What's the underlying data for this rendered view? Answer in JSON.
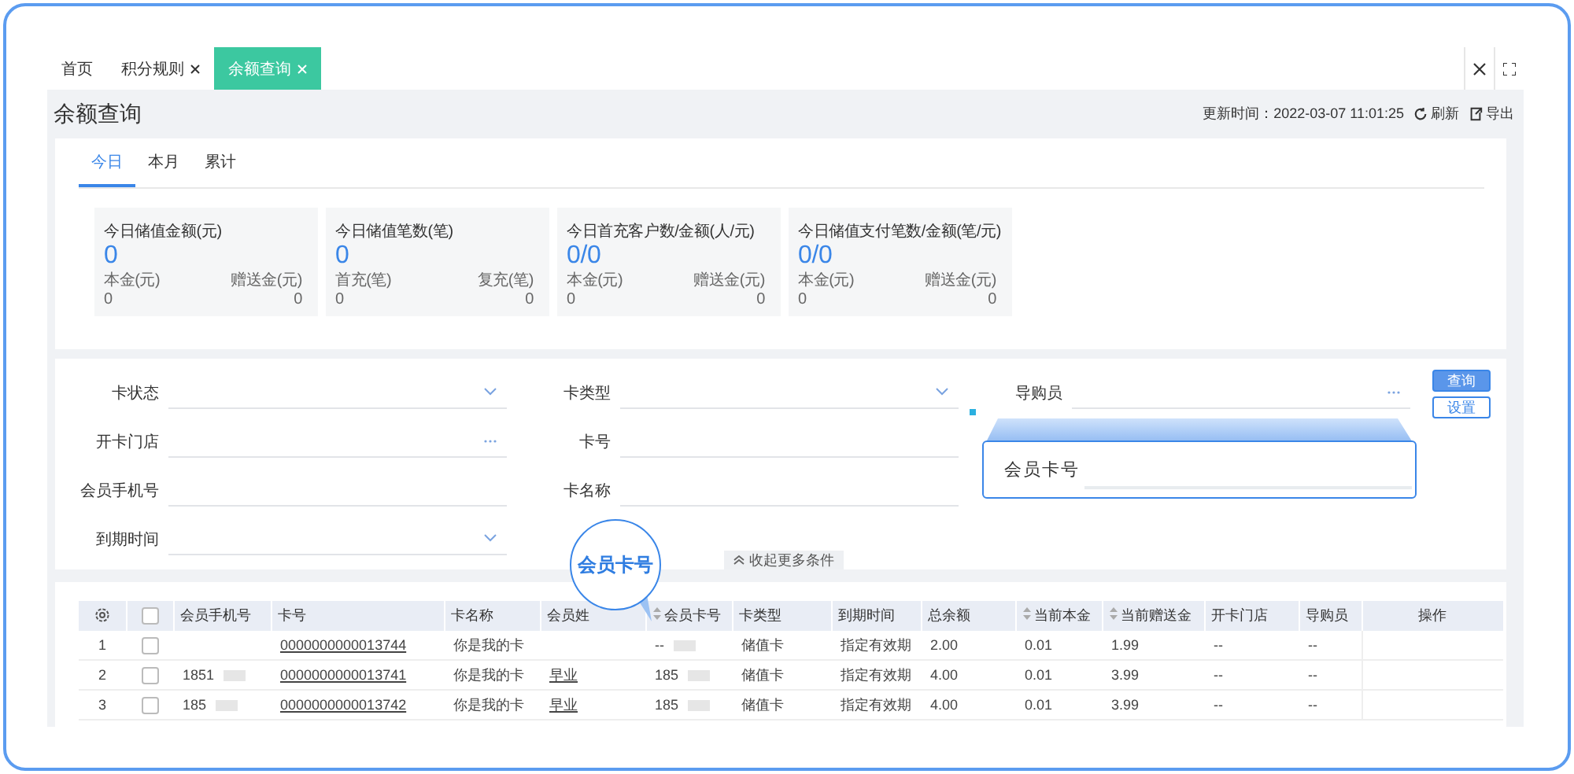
{
  "tabs": [
    {
      "label": "首页",
      "closable": false,
      "selected": false
    },
    {
      "label": "积分规则",
      "closable": true,
      "selected": false
    },
    {
      "label": "余额查询",
      "closable": true,
      "selected": true
    }
  ],
  "page_title": "余额查询",
  "update_time": "更新时间：2022-03-07 11:01:25",
  "actions": [
    "刷新",
    "导出"
  ],
  "period_tabs": [
    {
      "label": "今日",
      "selected": true
    },
    {
      "label": "本月",
      "selected": false
    },
    {
      "label": "累计",
      "selected": false
    }
  ],
  "stat_cards": [
    {
      "title": "今日储值金额(元)",
      "value": "0",
      "left_label": "本金(元)",
      "left_value": "0",
      "right_label": "赠送金(元)",
      "right_value": "0"
    },
    {
      "title": "今日储值笔数(笔)",
      "value": "0",
      "left_label": "首充(笔)",
      "left_value": "0",
      "right_label": "复充(笔)",
      "right_value": "0"
    },
    {
      "title": "今日首充客户数/金额(人/元)",
      "value": "0/0",
      "left_label": "本金(元)",
      "left_value": "0",
      "right_label": "赠送金(元)",
      "right_value": "0"
    },
    {
      "title": "今日储值支付笔数/金额(笔/元)",
      "value": "0/0",
      "left_label": "本金(元)",
      "left_value": "0",
      "right_label": "赠送金(元)",
      "right_value": "0"
    }
  ],
  "filters": [
    [
      {
        "label": "卡状态",
        "kind": "select"
      },
      {
        "label": "开卡门店",
        "kind": "picker"
      },
      {
        "label": "会员手机号",
        "kind": "text"
      },
      {
        "label": "到期时间",
        "kind": "select"
      }
    ],
    [
      {
        "label": "卡类型",
        "kind": "select"
      },
      {
        "label": "卡号",
        "kind": "text"
      },
      {
        "label": "卡名称",
        "kind": "text"
      }
    ],
    [
      {
        "label": "导购员",
        "kind": "picker"
      }
    ]
  ],
  "buttons": [
    "查询",
    "设置"
  ],
  "collapse_toggle": "收起更多条件",
  "callout_circle": "会员卡号",
  "callout_field": "会员卡号",
  "table": {
    "all_checked": false,
    "columns": [
      {
        "kind": "gear"
      },
      {
        "kind": "check"
      },
      {
        "label": "会员手机号",
        "kind": "text"
      },
      {
        "label": "卡号",
        "kind": "text"
      },
      {
        "label": "卡名称",
        "kind": "text"
      },
      {
        "label": "会员姓",
        "kind": "text"
      },
      {
        "label": "会员卡号",
        "kind": "sort"
      },
      {
        "label": "卡类型",
        "kind": "text"
      },
      {
        "label": "到期时间",
        "kind": "text"
      },
      {
        "label": "总余额",
        "kind": "text"
      },
      {
        "label": "当前本金",
        "kind": "sort"
      },
      {
        "label": "当前赠送金",
        "kind": "sort"
      },
      {
        "label": "开卡门店",
        "kind": "text"
      },
      {
        "label": "导购员",
        "kind": "text"
      },
      {
        "label": "操作",
        "kind": "text"
      }
    ],
    "rows": [
      {
        "checked": false,
        "cells": [
          "1",
          "",
          "",
          "0000000000013744",
          "你是我的卡",
          "",
          "--",
          "储值卡",
          "指定有效期",
          "2.00",
          "0.01",
          "1.99",
          "--",
          "--",
          ""
        ]
      },
      {
        "checked": false,
        "cells": [
          "2",
          "",
          "1851",
          "0000000000013741",
          "你是我的卡",
          "早业",
          "185",
          "储值卡",
          "指定有效期",
          "4.00",
          "0.01",
          "3.99",
          "--",
          "--",
          ""
        ]
      },
      {
        "checked": false,
        "cells": [
          "3",
          "",
          "185",
          "0000000000013742",
          "你是我的卡",
          "早业",
          "185",
          "储值卡",
          "指定有效期",
          "4.00",
          "0.01",
          "3.99",
          "--",
          "--",
          ""
        ]
      }
    ]
  }
}
